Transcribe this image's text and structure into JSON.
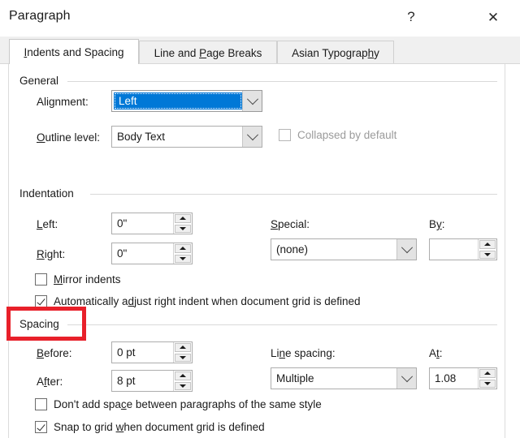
{
  "window": {
    "title": "Paragraph",
    "help_glyph": "?",
    "close_glyph": "✕"
  },
  "tabs": [
    {
      "label": "Indents and Spacing",
      "accel": "I",
      "active": true
    },
    {
      "label": "Line and Page Breaks",
      "accel": "P",
      "active": false
    },
    {
      "label": "Asian Typography",
      "accel": "h",
      "active": false
    }
  ],
  "general": {
    "group_label": "General",
    "alignment_label": "Alignment:",
    "alignment_accel": "g",
    "alignment_value": "Left",
    "outline_label": "Outline level:",
    "outline_accel": "O",
    "outline_value": "Body Text",
    "collapsed_label": "Collapsed by default",
    "collapsed_checked": false,
    "collapsed_disabled": true
  },
  "indentation": {
    "group_label": "Indentation",
    "left_label": "Left:",
    "left_accel": "L",
    "left_value": "0\"",
    "right_label": "Right:",
    "right_accel": "R",
    "right_value": "0\"",
    "special_label": "Special:",
    "special_accel": "S",
    "special_value": "(none)",
    "by_label": "By:",
    "by_accel": "y",
    "by_value": "",
    "mirror_label": "Mirror indents",
    "mirror_accel": "M",
    "mirror_checked": false,
    "autoadjust_label": "Automatically adjust right indent when document grid is defined",
    "autoadjust_accel": "d",
    "autoadjust_checked": true
  },
  "spacing": {
    "group_label": "Spacing",
    "before_label": "Before:",
    "before_accel": "B",
    "before_value": "0 pt",
    "after_label": "After:",
    "after_accel": "f",
    "after_value": "8 pt",
    "line_spacing_label": "Line spacing:",
    "line_spacing_accel": "n",
    "line_spacing_value": "Multiple",
    "at_label": "At:",
    "at_accel": "t",
    "at_value": "1.08",
    "dont_add_label": "Don't add space between paragraphs of the same style",
    "dont_add_accel": "c",
    "dont_add_checked": false,
    "snap_label": "Snap to grid when document grid is defined",
    "snap_accel": "w",
    "snap_checked": true
  },
  "annotation": {
    "color": "#e8202a",
    "target": "Spacing"
  }
}
